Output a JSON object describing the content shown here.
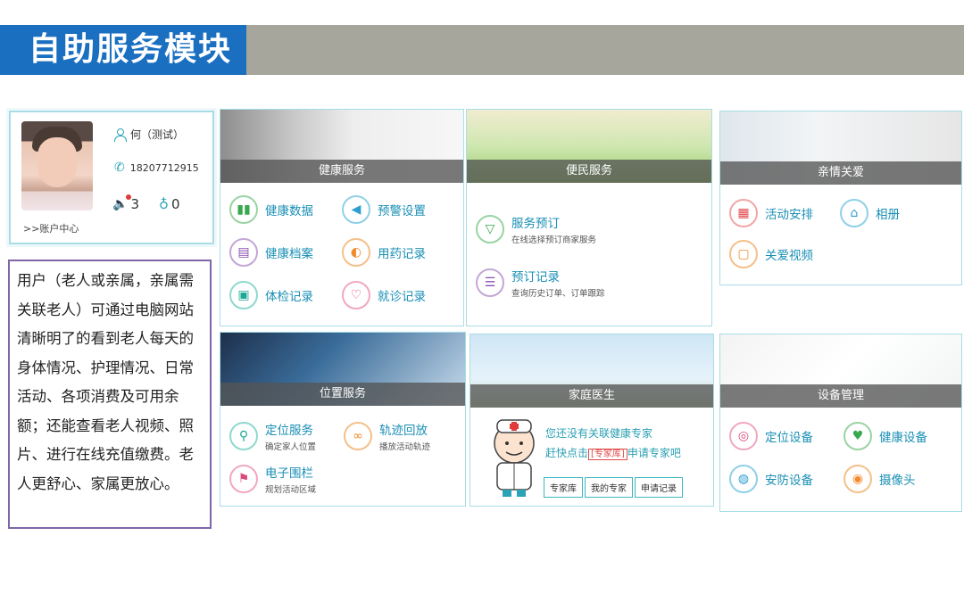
{
  "title": "自助服务模块",
  "user": {
    "name": "何（测试）",
    "phone": "18207712915",
    "messages": "3",
    "alerts": "0",
    "account_link": ">>账户中心"
  },
  "description": "用户（老人或亲属，亲属需关联老人）可通过电脑网站清晰明了的看到老人每天的身体情况、护理情况、日常活动、各项消费及可用余额；还能查看老人视频、照片、进行在线充值缴费。老人更舒心、家属更放心。",
  "panels": {
    "health": {
      "title": "健康服务",
      "items": [
        "健康数据",
        "预警设置",
        "健康档案",
        "用药记录",
        "体检记录",
        "就诊记录"
      ]
    },
    "convenience": {
      "title": "便民服务",
      "items": [
        {
          "label": "服务预订",
          "sub": "在线选择预订商家服务"
        },
        {
          "label": "预订记录",
          "sub": "查询历史订单、订单跟踪"
        }
      ]
    },
    "family": {
      "title": "亲情关爱",
      "items": [
        "活动安排",
        "相册",
        "关爱视频"
      ]
    },
    "location": {
      "title": "位置服务",
      "items": [
        {
          "label": "定位服务",
          "sub": "确定家人位置"
        },
        {
          "label": "轨迹回放",
          "sub": "播放活动轨迹"
        },
        {
          "label": "电子围栏",
          "sub": "规划活动区域"
        }
      ]
    },
    "doctor": {
      "title": "家庭医生",
      "line1": "您还没有关联健康专家",
      "line2_pre": "赶快点击",
      "line2_tag": "[专家库]",
      "line2_post": "申请专家吧",
      "buttons": [
        "专家库",
        "我的专家",
        "申请记录"
      ]
    },
    "device": {
      "title": "设备管理",
      "items": [
        "定位设备",
        "健康设备",
        "安防设备",
        "摄像头"
      ]
    }
  },
  "colors": {
    "title_blue": "#1a6fc0",
    "title_gray": "#a6a69c",
    "panel_border": "#a8dde6",
    "link_blue": "#1a8fb5",
    "desc_border": "#8066a8"
  }
}
